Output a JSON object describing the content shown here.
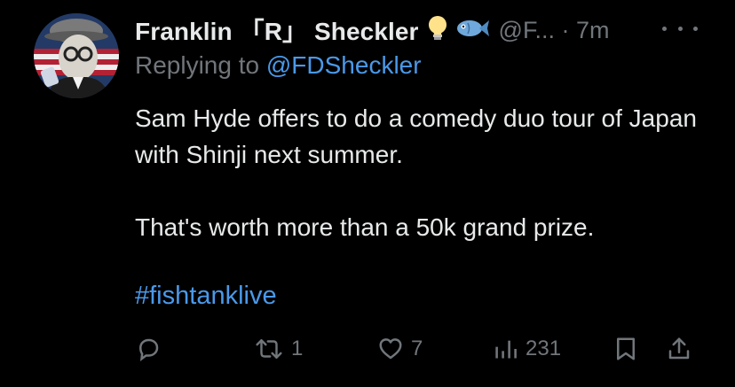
{
  "author": {
    "name": "Franklin 「R」 Sheckler",
    "handle_time": "@F... · 7m",
    "emojis": [
      "lightbulb-icon",
      "fish-icon"
    ]
  },
  "reply": {
    "prefix": "Replying to ",
    "mention": "@FDSheckler"
  },
  "body": {
    "line1": "Sam Hyde offers to do a comedy duo tour of Japan with Shinji next summer.",
    "line2": "That's worth more than a 50k grand prize.",
    "hashtag": "#fishtanklive"
  },
  "actions": {
    "replies": "",
    "retweets": "1",
    "likes": "7",
    "views": "231"
  },
  "colors": {
    "background": "#000000",
    "text": "#e7e9ea",
    "muted": "#71767b",
    "link": "#4a99e9"
  }
}
